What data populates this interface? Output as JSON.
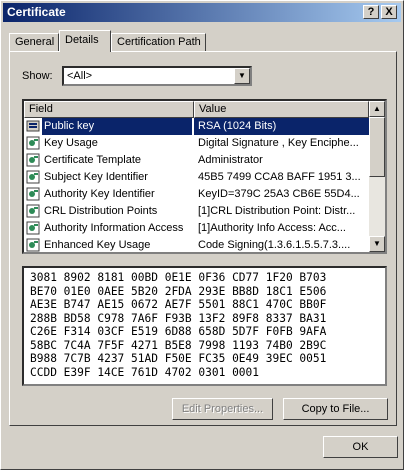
{
  "window": {
    "title": "Certificate",
    "help_label": "?",
    "close_label": "X"
  },
  "tabs": [
    {
      "label": "General"
    },
    {
      "label": "Details"
    },
    {
      "label": "Certification Path"
    }
  ],
  "show": {
    "label": "Show:",
    "selected": "<All>"
  },
  "list": {
    "headers": {
      "field": "Field",
      "value": "Value"
    },
    "rows": [
      {
        "field": "Public key",
        "value": "RSA (1024 Bits)",
        "icon": "public-key-icon",
        "selected": true
      },
      {
        "field": "Key Usage",
        "value": "Digital Signature , Key Enciphe...",
        "icon": "extension-icon"
      },
      {
        "field": "Certificate Template",
        "value": "Administrator",
        "icon": "extension-icon"
      },
      {
        "field": "Subject Key Identifier",
        "value": "45B5 7499 CCA8 BAFF 1951 3...",
        "icon": "extension-icon"
      },
      {
        "field": "Authority Key Identifier",
        "value": "KeyID=379C 25A3 CB6E 55D4...",
        "icon": "extension-icon"
      },
      {
        "field": "CRL Distribution Points",
        "value": "[1]CRL Distribution Point: Distr...",
        "icon": "extension-icon"
      },
      {
        "field": "Authority Information Access",
        "value": "[1]Authority Info Access: Acc...",
        "icon": "extension-icon"
      },
      {
        "field": "Enhanced Key Usage",
        "value": "Code Signing(1.3.6.1.5.5.7.3....",
        "icon": "extension-icon"
      }
    ]
  },
  "hex": [
    "3081 8902 8181 00BD 0E1E 0F36 CD77 1F20 B703",
    "BE70 01E0 0AEE 5B20 2FDA 293E BB8D 18C1 E506",
    "AE3E B747 AE15 0672 AE7F 5501 88C1 470C BB0F",
    "288B BD58 C978 7A6F F93B 13F2 89F8 8337 BA31",
    "C26E F314 03CF E519 6D88 658D 5D7F F0FB 9AFA",
    "58BC 7C4A 7F5F 4271 B5E8 7998 1193 74B0 2B9C",
    "B988 7C7B 4237 51AD F50E FC35 0E49 39EC 0051",
    "CCDD E39F 14CE 761D 4702 0301 0001"
  ],
  "buttons": {
    "edit_properties": "Edit Properties...",
    "copy_to_file": "Copy to File...",
    "ok": "OK"
  }
}
